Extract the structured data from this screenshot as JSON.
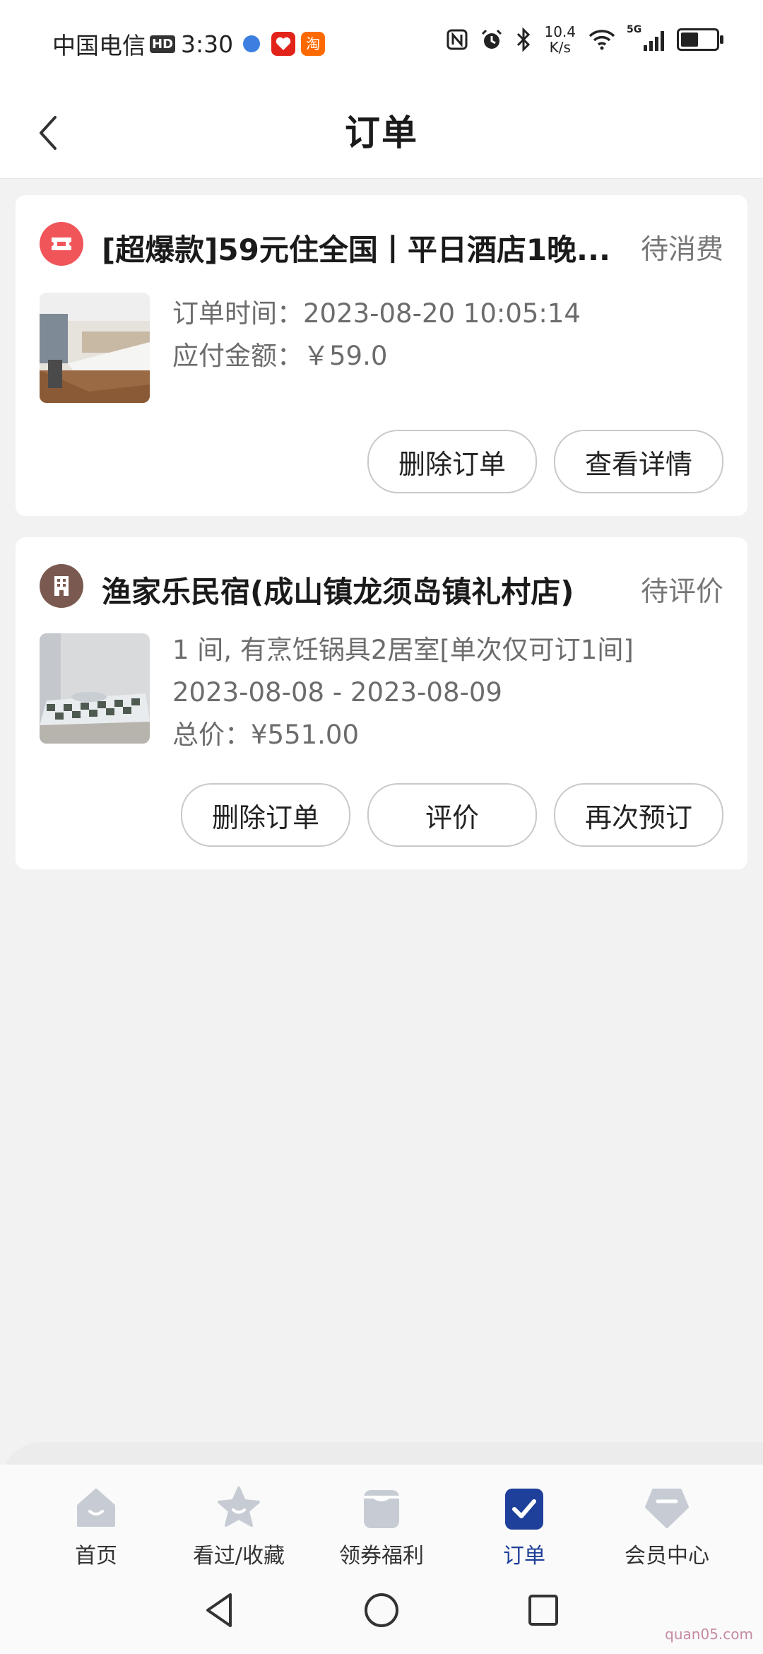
{
  "status_bar": {
    "carrier": "中国电信",
    "hd": "HD",
    "time": "3:30",
    "app_tao": "淘",
    "speed_value": "10.4",
    "speed_unit": "K/s",
    "network": "5G"
  },
  "header": {
    "title": "订单"
  },
  "orders": [
    {
      "title": "[超爆款]59元住全国丨平日酒店1晚...",
      "status": "待消费",
      "line1": "订单时间：2023-08-20 10:05:14",
      "line2": "应付金额：￥59.0",
      "buttons": [
        "删除订单",
        "查看详情"
      ],
      "icon": "ticket-icon",
      "icon_color": "#f0555a"
    },
    {
      "title": "渔家乐民宿(成山镇龙须岛镇礼村店)",
      "status": "待评价",
      "line1": "1 间, 有烹饪锅具2居室[单次仅可订1间]",
      "line2": "2023-08-08 - 2023-08-09",
      "line3": "总价：¥551.00",
      "buttons": [
        "删除订单",
        "评价",
        "再次预订"
      ],
      "icon": "building-icon",
      "icon_color": "#7a5a50"
    }
  ],
  "bottom_nav": {
    "items": [
      {
        "label": "首页",
        "icon": "home-icon"
      },
      {
        "label": "看过/收藏",
        "icon": "star-icon"
      },
      {
        "label": "领券福利",
        "icon": "coupon-icon"
      },
      {
        "label": "订单",
        "icon": "order-check-icon",
        "active": true
      },
      {
        "label": "会员中心",
        "icon": "member-icon"
      }
    ],
    "active_color": "#1e3f9a"
  },
  "watermark": "quan05.com"
}
